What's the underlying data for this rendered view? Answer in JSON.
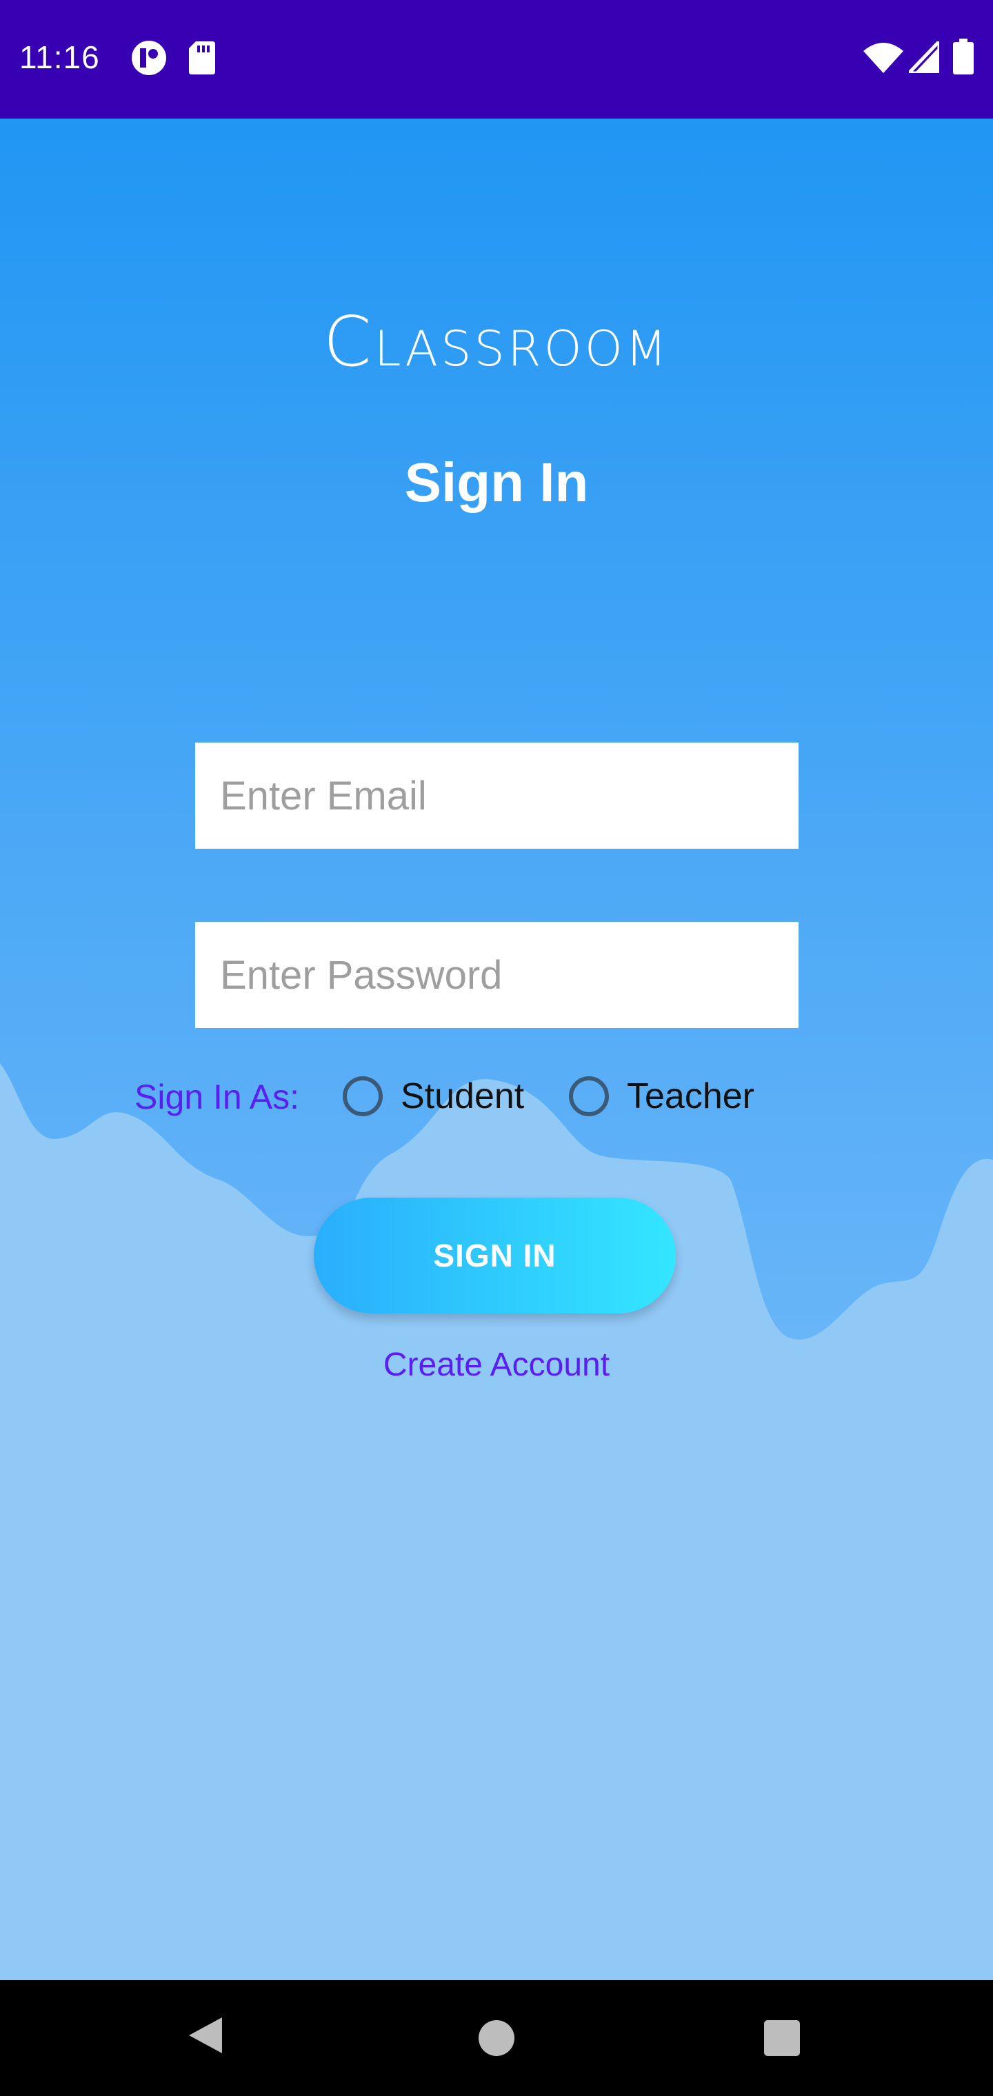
{
  "status_bar": {
    "time": "11:16",
    "left_icons": [
      "app-notification-icon",
      "sd-card-icon"
    ],
    "right_icons": [
      "wifi-icon",
      "cell-signal-icon",
      "battery-icon"
    ],
    "background": "#3700b3"
  },
  "app": {
    "title": "Classroom",
    "subtitle": "Sign In",
    "email_placeholder": "Enter Email",
    "email_value": "",
    "password_placeholder": "Enter Password",
    "password_value": "",
    "sign_in_as_label": "Sign In As:",
    "roles": [
      {
        "label": "Student",
        "selected": false
      },
      {
        "label": "Teacher",
        "selected": false
      }
    ],
    "sign_in_button": "SIGN IN",
    "create_account_link": "Create Account"
  },
  "colors": {
    "gradient_top": "#2196f3",
    "gradient_bottom": "#5eb1f7",
    "lower_background": "#90c8f6",
    "accent_text": "#5a1ff0",
    "button_gradient_start": "#2aaefc",
    "button_gradient_end": "#33e6ff"
  },
  "nav_bar": {
    "icons": [
      "back-icon",
      "home-icon",
      "recents-icon"
    ]
  }
}
